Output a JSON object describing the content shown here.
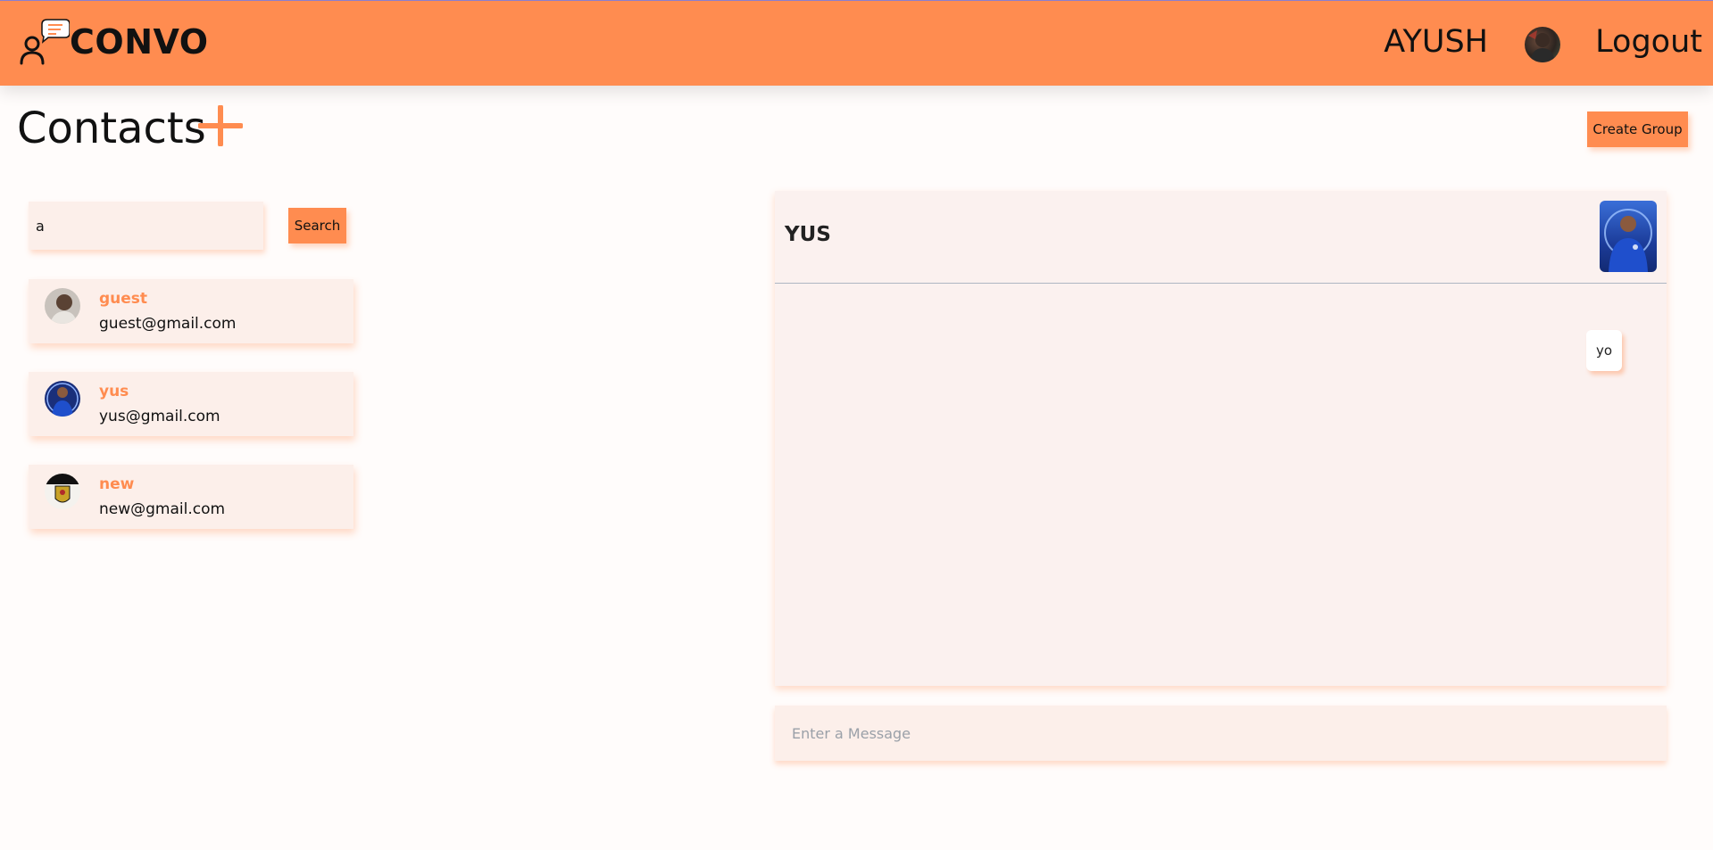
{
  "header": {
    "brand": "CONVO",
    "user_name": "AYUSH",
    "logout_label": "Logout"
  },
  "contacts": {
    "title": "Contacts",
    "create_group_label": "Create Group",
    "search_value": "a",
    "search_button_label": "Search",
    "list": [
      {
        "name": "guest",
        "email": "guest@gmail.com"
      },
      {
        "name": "yus",
        "email": "yus@gmail.com"
      },
      {
        "name": "new",
        "email": "new@gmail.com"
      }
    ]
  },
  "chat": {
    "title": "YUS",
    "messages": [
      {
        "text": "yo"
      }
    ],
    "input_placeholder": "Enter a Message"
  },
  "colors": {
    "accent": "#ff8c50",
    "card_bg": "#fcefea",
    "chat_bg": "#fbf1ef"
  },
  "icons": [
    "chat-bubble-logo-icon",
    "user-avatar",
    "add-contact-icon"
  ]
}
